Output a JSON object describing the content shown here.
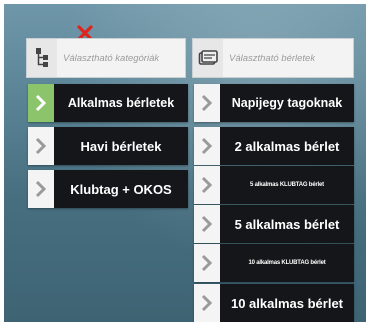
{
  "header": {
    "category_placeholder": "Választható kategóriák",
    "pass_placeholder": "Választható bérletek"
  },
  "categories": [
    {
      "label": "Alkalmas bérletek",
      "active": true,
      "icon": "chevron-right-icon"
    },
    {
      "label": "Havi bérletek",
      "active": false,
      "icon": "chevron-right-icon"
    },
    {
      "label": "Klubtag + OKOS",
      "active": false,
      "icon": "chevron-right-icon"
    }
  ],
  "passes": [
    {
      "label": "Napijegy tagoknak",
      "icon": "chevron-right-icon"
    },
    {
      "label": "2 alkalmas bérlet",
      "icon": "chevron-right-icon"
    },
    {
      "label": "5 alkalmas KLUBTAG bérlet",
      "icon": "chevron-right-icon"
    },
    {
      "label": "5 alkalmas bérlet",
      "icon": "chevron-right-icon"
    },
    {
      "label": "10 alkalmas KLUBTAG bérlet",
      "icon": "chevron-right-icon"
    },
    {
      "label": "10 alkalmas bérlet",
      "icon": "chevron-right-icon"
    }
  ],
  "colors": {
    "active_accent": "#8bc46b",
    "button_bg": "#15161a",
    "close_mark": "#e0231c"
  },
  "icons": [
    "close-icon",
    "category-tree-icon",
    "pass-card-icon",
    "chevron-right-icon"
  ]
}
